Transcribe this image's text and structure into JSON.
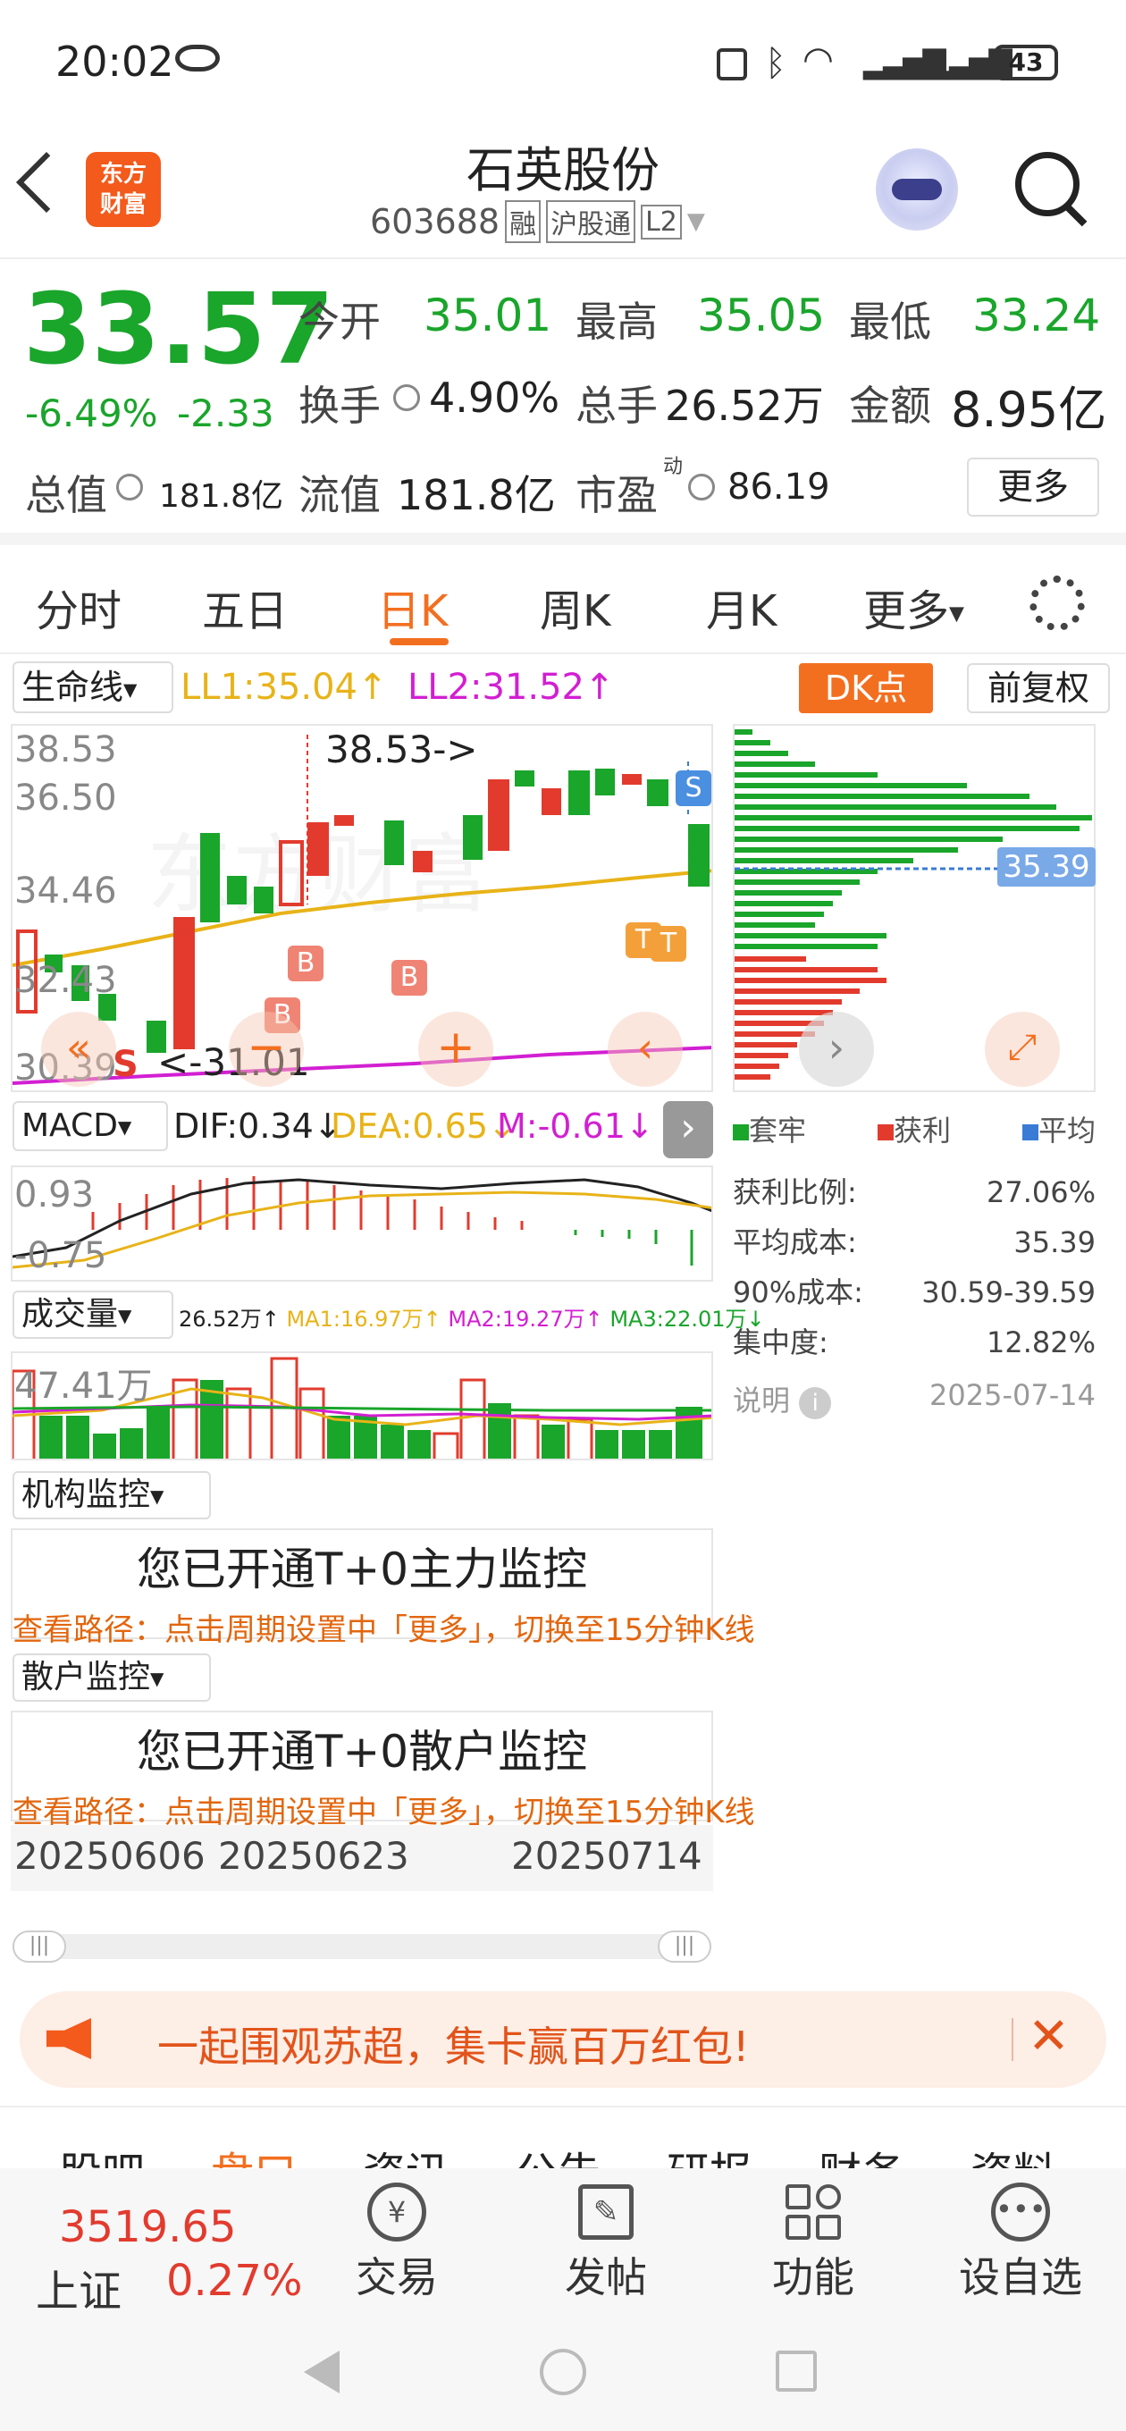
{
  "status_bar": {
    "time": "20:02",
    "battery": "43"
  },
  "header": {
    "title": "石英股份",
    "code": "603688",
    "badges": [
      "融",
      "沪股通",
      "L2"
    ],
    "back_icon": "back-icon",
    "logo_line1": "东方",
    "logo_line2": "财富"
  },
  "quote": {
    "price": "33.57",
    "change_pct": "-6.49%",
    "change_amt": "-2.33",
    "open_label": "今开",
    "open": "35.01",
    "high_label": "最高",
    "high": "35.05",
    "low_label": "最低",
    "low": "33.24",
    "turnover_label": "换手",
    "turnover": "4.90%",
    "volume_label": "总手",
    "volume": "26.52万",
    "amount_label": "金额",
    "amount": "8.95亿",
    "mktcap_label": "总值",
    "mktcap": "181.8亿",
    "float_label": "流值",
    "float": "181.8亿",
    "pe_label": "市盈",
    "pe_sup": "动",
    "pe": "86.19",
    "more": "更多"
  },
  "tabs": [
    "分时",
    "五日",
    "日K",
    "周K",
    "月K",
    "更多"
  ],
  "active_tab": "日K",
  "indicator": {
    "name": "生命线",
    "ll1": "LL1:35.04",
    "ll2": "LL2:31.52",
    "dk": "DK点",
    "adjust": "前复权"
  },
  "kline": {
    "y_labels": [
      "38.53",
      "36.50",
      "34.46",
      "32.43",
      "30.39"
    ],
    "high_note": "38.53->",
    "low_note": "<-31.01",
    "cost_line": "35.39"
  },
  "macd": {
    "name": "MACD",
    "dif": "DIF:0.34",
    "dea": "DEA:0.65",
    "m": "M:-0.61",
    "y_top": "0.93",
    "y_bottom": "-0.75"
  },
  "volume": {
    "name": "成交量",
    "v": "26.52万",
    "ma1": "MA1:16.97万",
    "ma2": "MA2:19.27万",
    "ma3": "MA3:22.01万",
    "y_top": "47.41万"
  },
  "inst": {
    "name": "机构监控",
    "title": "您已开通T+0主力监控",
    "path": "查看路径：点击周期设置中「更多」，切换至15分钟K线"
  },
  "retail": {
    "name": "散户监控",
    "title": "您已开通T+0散户监控",
    "path": "查看路径：点击周期设置中「更多」，切换至15分钟K线"
  },
  "dates": [
    "20250606",
    "20250623",
    "20250714"
  ],
  "chips": {
    "legend": [
      "套牢",
      "获利",
      "平均"
    ],
    "rows": [
      {
        "k": "获利比例:",
        "v": "27.06%"
      },
      {
        "k": "平均成本:",
        "v": "35.39"
      },
      {
        "k": "90%成本:",
        "v": "30.59-39.59"
      },
      {
        "k": "集中度:",
        "v": "12.82%"
      }
    ],
    "note_label": "说明",
    "note_date": "2025-07-14"
  },
  "banner": {
    "text": "一起围观苏超，集卡赢百万红包!"
  },
  "subtabs": [
    "股吧",
    "盘口",
    "资讯",
    "公告",
    "研报",
    "财务",
    "资料"
  ],
  "bottom": {
    "index_value": "3519.65",
    "index_name": "上证",
    "index_pct": "0.27%",
    "items": [
      "交易",
      "发帖",
      "功能",
      "设自选"
    ]
  },
  "colors": {
    "up": "#e23b2e",
    "down": "#1aa52b",
    "accent": "#f36f20",
    "ma_yellow": "#e8b318",
    "ma_magenta": "#d21fd2"
  }
}
